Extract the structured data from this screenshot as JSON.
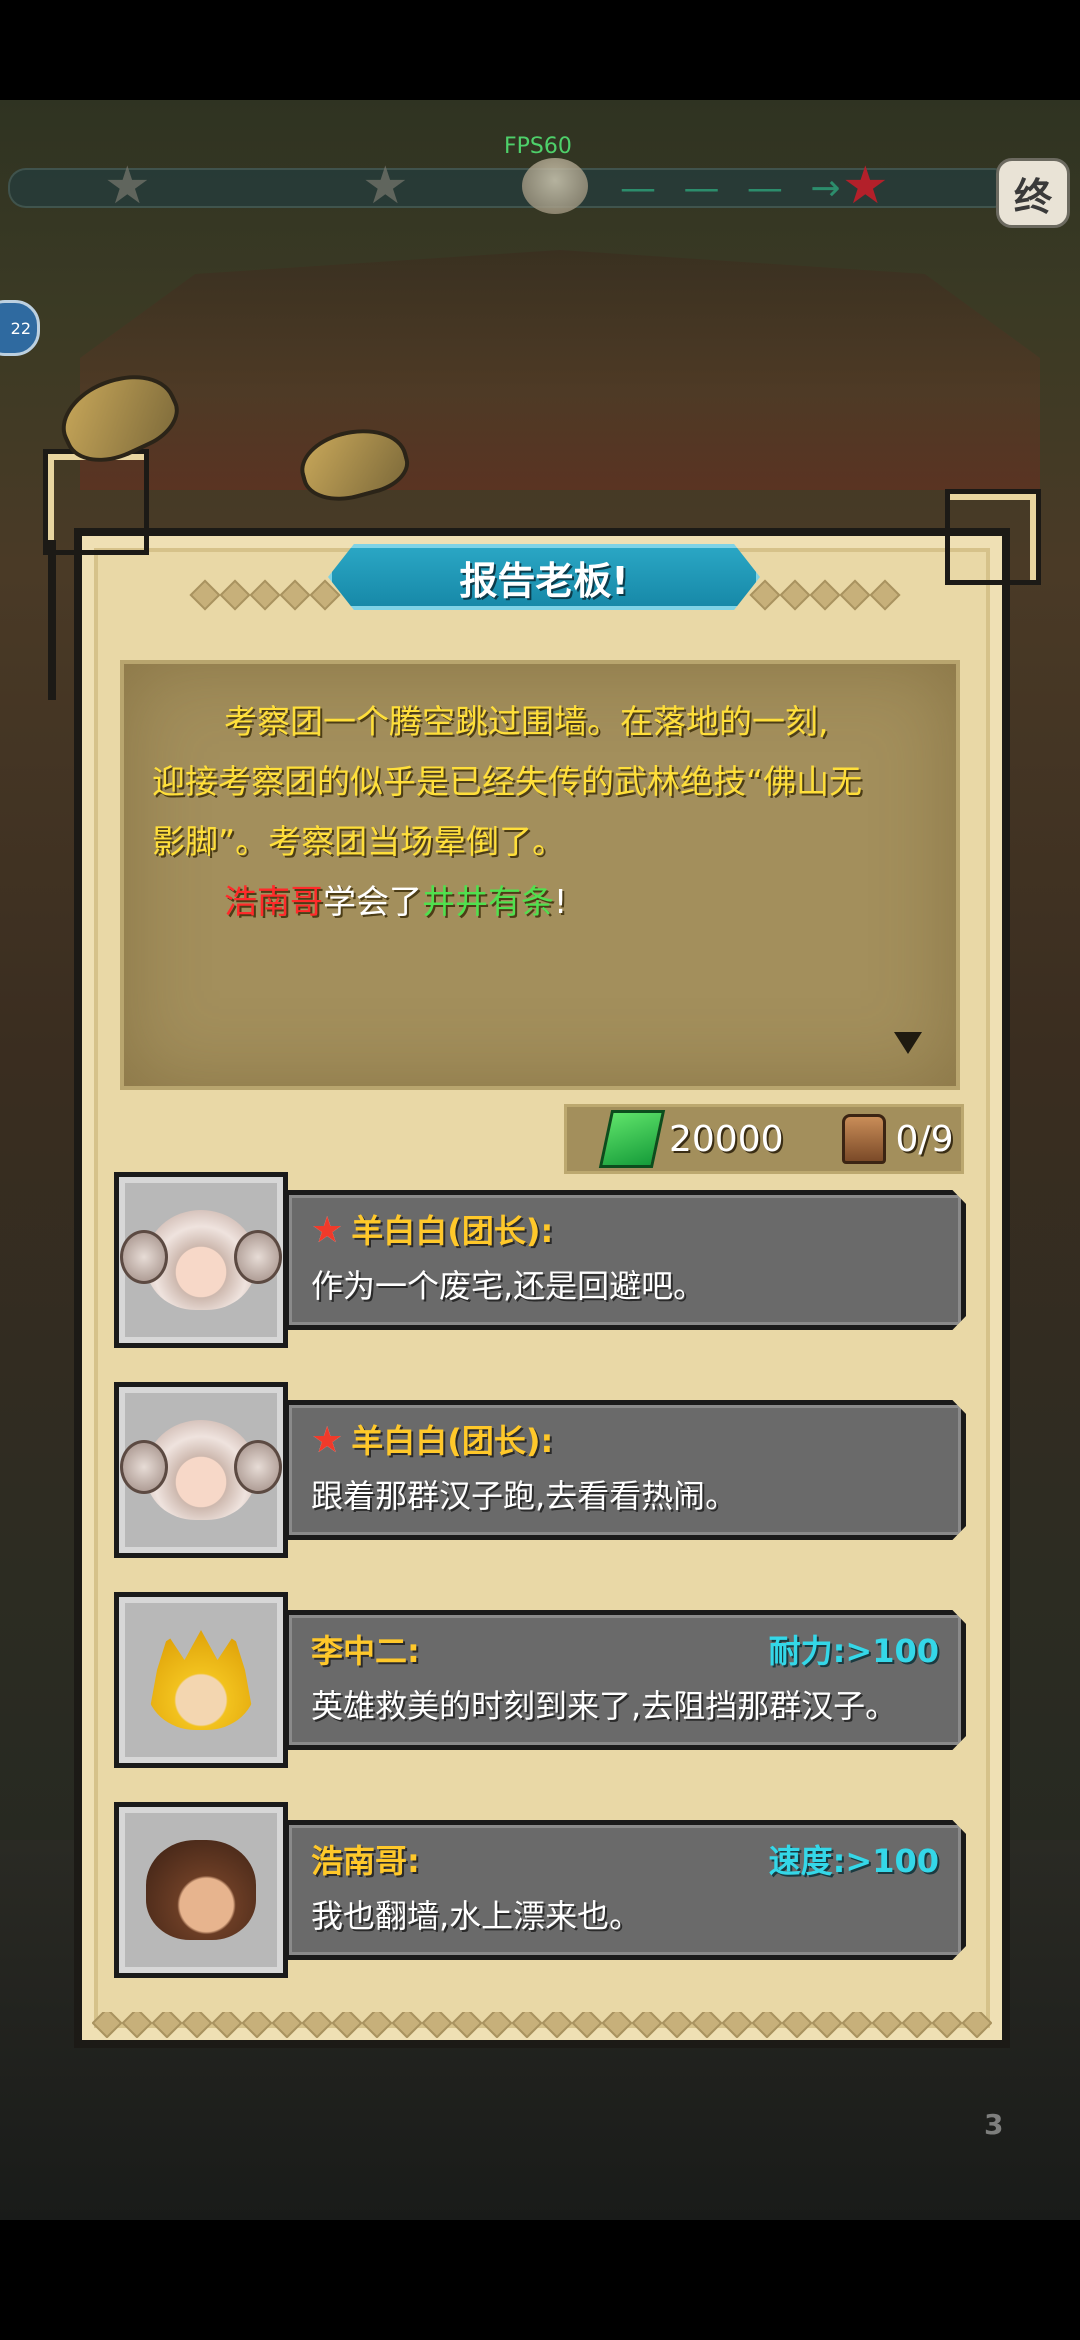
{
  "hud": {
    "fps": "FPS60",
    "end_label": "终",
    "side_badge": "22",
    "scroll_count": "3"
  },
  "dialog": {
    "title": "报告老板!",
    "story_line1": "考察团一个腾空跳过围墙。在落地的一刻,",
    "story_line2": "迎接考察团的似乎是已经失传的武林绝技“佛山无",
    "story_line3": "影脚”。考察团当场晕倒了。",
    "learn_name": "浩南哥",
    "learn_mid": "学会了",
    "learn_skill": "井井有条",
    "learn_end": "!"
  },
  "resources": {
    "money": "20000",
    "items": "0/9"
  },
  "options": [
    {
      "speaker": "羊白白(团长):",
      "text": "作为一个废宅,还是回避吧。",
      "requirement": ""
    },
    {
      "speaker": "羊白白(团长):",
      "text": "跟着那群汉子跑,去看看热闹。",
      "requirement": ""
    },
    {
      "speaker": "李中二:",
      "text": "英雄救美的时刻到来了,去阻挡那群汉子。",
      "requirement": "耐力:>100"
    },
    {
      "speaker": "浩南哥:",
      "text": "我也翻墙,水上漂来也。",
      "requirement": "速度:>100"
    }
  ],
  "colors": {
    "story_text": "#ffdf3a",
    "name_red": "#ff2a2a",
    "skill_green": "#50e04e",
    "speaker_yellow": "#ffc82a",
    "requirement_cyan": "#34d7e8",
    "banner_blue": "#1f97b6"
  }
}
